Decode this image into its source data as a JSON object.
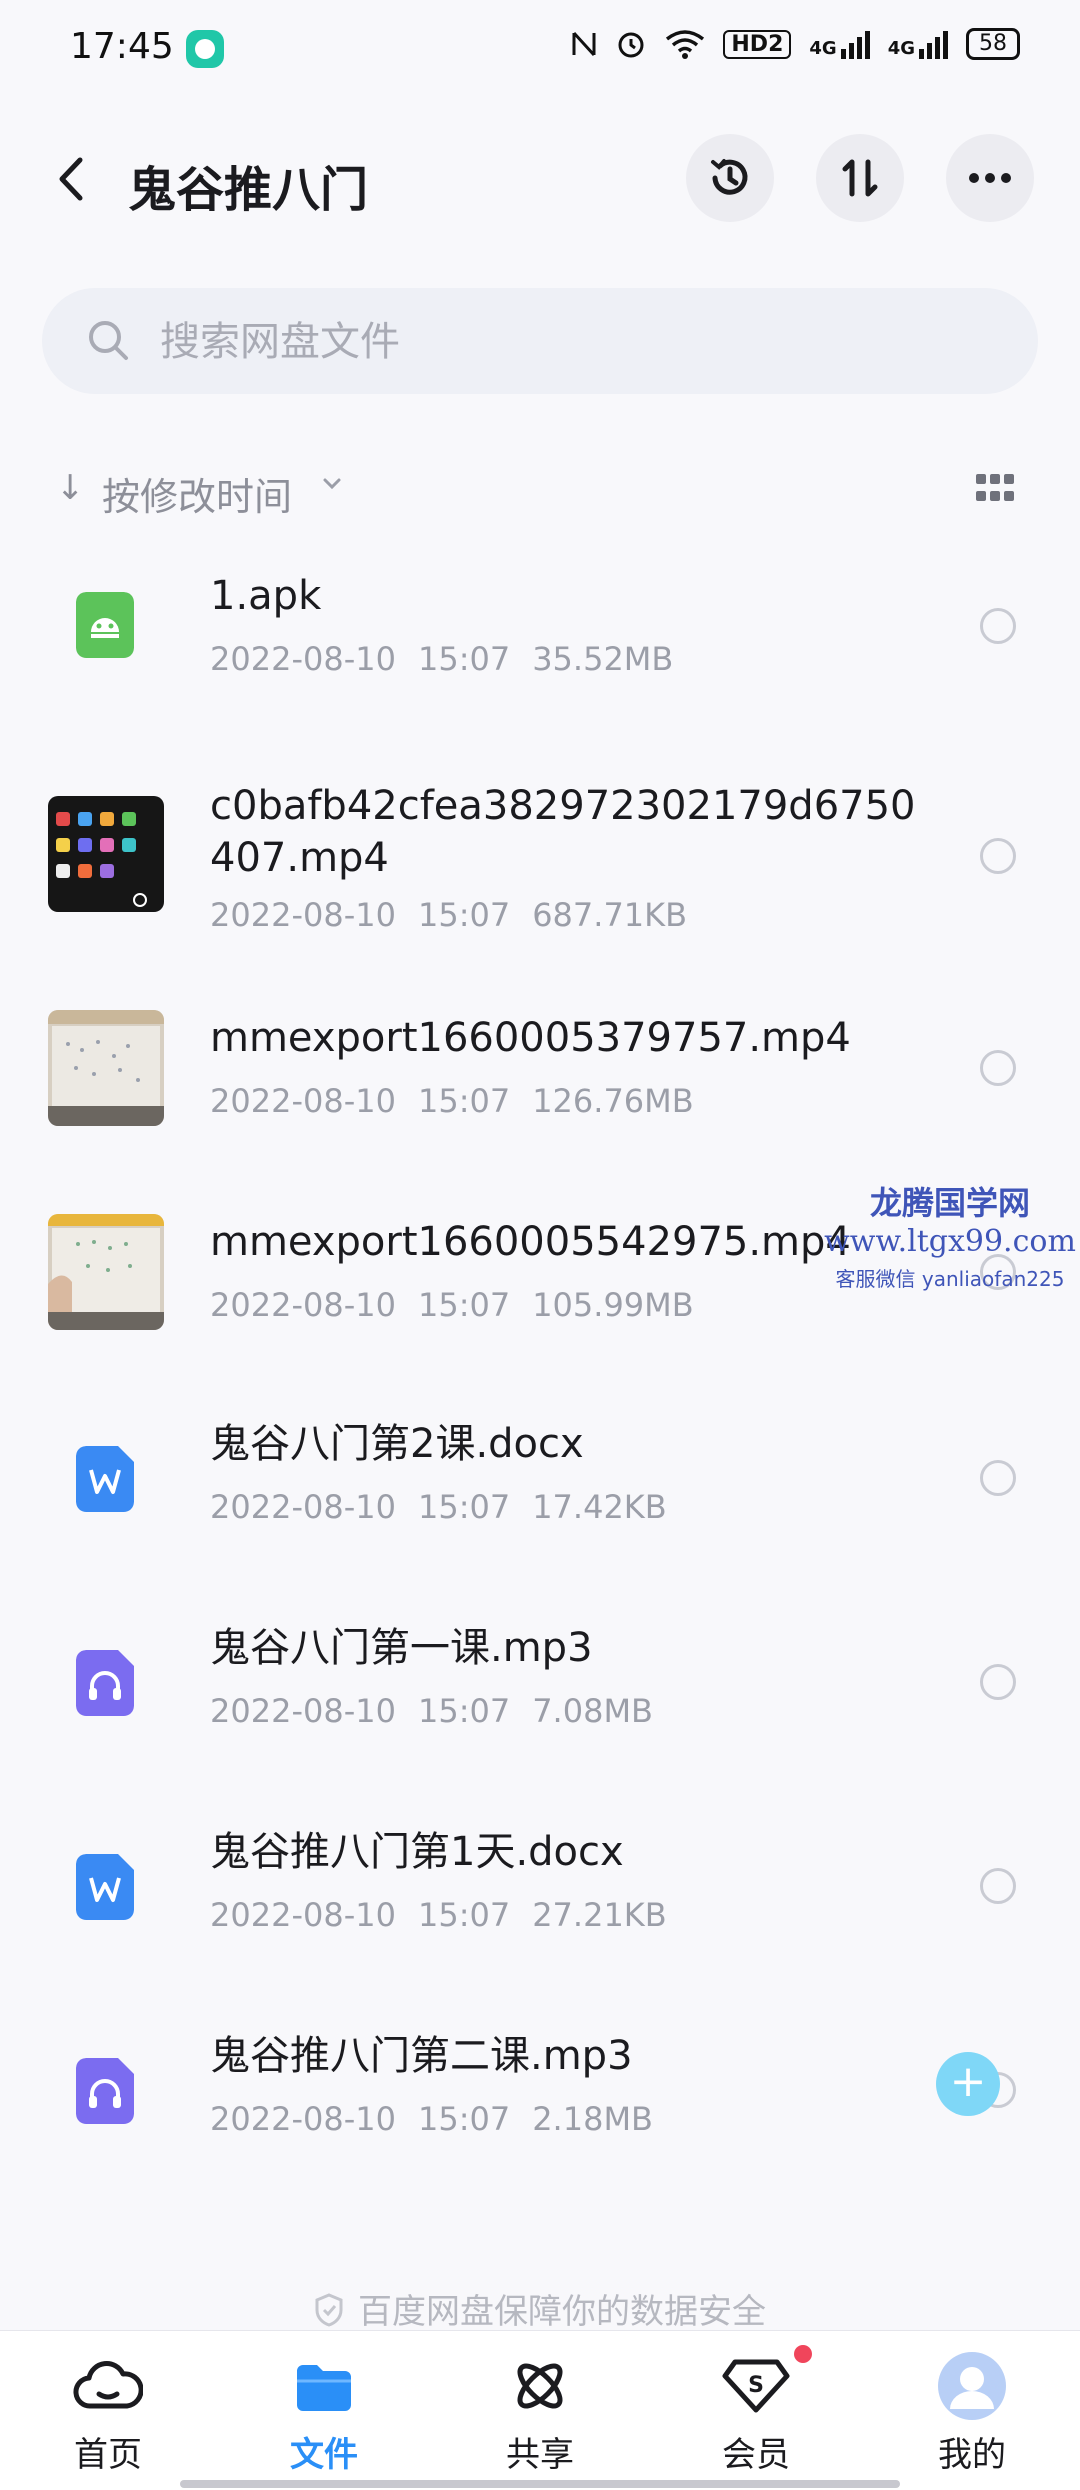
{
  "status": {
    "time": "17:45",
    "network_badge": "HD2",
    "sig1": "4G",
    "sig2": "4G",
    "battery": "58"
  },
  "header": {
    "title": "鬼谷推八门"
  },
  "search": {
    "placeholder": "搜索网盘文件"
  },
  "sort": {
    "label": "按修改时间"
  },
  "files": [
    {
      "name": "1.apk",
      "date": "2022-08-10",
      "time": "15:07",
      "size": "35.52MB",
      "icon": "android-apk-icon"
    },
    {
      "name": "c0bafb42cfea382972302179d6750407.mp4",
      "date": "2022-08-10",
      "time": "15:07",
      "size": "687.71KB",
      "icon": "video-thumbnail"
    },
    {
      "name": "mmexport1660005379757.mp4",
      "date": "2022-08-10",
      "time": "15:07",
      "size": "126.76MB",
      "icon": "video-thumbnail"
    },
    {
      "name": "mmexport1660005542975.mp4",
      "date": "2022-08-10",
      "time": "15:07",
      "size": "105.99MB",
      "icon": "video-thumbnail"
    },
    {
      "name": "鬼谷八门第2课.docx",
      "date": "2022-08-10",
      "time": "15:07",
      "size": "17.42KB",
      "icon": "word-doc-icon"
    },
    {
      "name": "鬼谷八门第一课.mp3",
      "date": "2022-08-10",
      "time": "15:07",
      "size": "7.08MB",
      "icon": "audio-file-icon"
    },
    {
      "name": "鬼谷推八门第1天.docx",
      "date": "2022-08-10",
      "time": "15:07",
      "size": "27.21KB",
      "icon": "word-doc-icon"
    },
    {
      "name": "鬼谷推八门第二课.mp3",
      "date": "2022-08-10",
      "time": "15:07",
      "size": "2.18MB",
      "icon": "audio-file-icon"
    }
  ],
  "watermark": {
    "line1": "龙腾国学网",
    "line2": "www.ltgx99.com",
    "line3": "客服微信 yanliaofan225"
  },
  "footer": {
    "text": "百度网盘保障你的数据安全"
  },
  "nav": [
    {
      "label": "首页",
      "icon": "cloud-home-icon"
    },
    {
      "label": "文件",
      "icon": "folder-icon"
    },
    {
      "label": "共享",
      "icon": "share-atom-icon"
    },
    {
      "label": "会员",
      "icon": "vip-diamond-icon"
    },
    {
      "label": "我的",
      "icon": "avatar"
    }
  ],
  "colors": {
    "accent": "#2a8ff7",
    "apk": "#5cc35a",
    "word": "#3a8af3",
    "audio": "#7b6cf0",
    "badge": "#f0455b"
  }
}
